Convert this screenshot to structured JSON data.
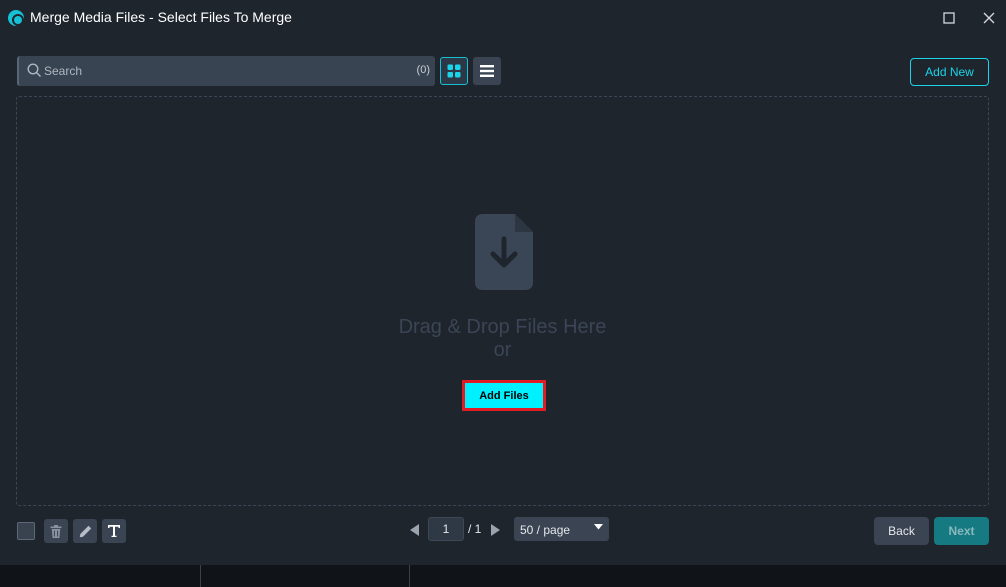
{
  "window": {
    "title": "Merge Media Files - Select Files To Merge"
  },
  "toolbar": {
    "search_placeholder": "Search",
    "search_count": "(0)",
    "add_new_label": "Add New"
  },
  "drop_zone": {
    "line1": "Drag & Drop Files Here",
    "line2": "or",
    "add_files_label": "Add Files"
  },
  "pagination": {
    "current_page": "1",
    "total_label": "/ 1",
    "per_page_label": "50 / page"
  },
  "footer": {
    "back_label": "Back",
    "next_label": "Next"
  },
  "colors": {
    "background": "#1f252d",
    "accent": "#1ad4e8",
    "add_files_fill": "#00f0ff",
    "highlight_border": "#e01b24"
  }
}
